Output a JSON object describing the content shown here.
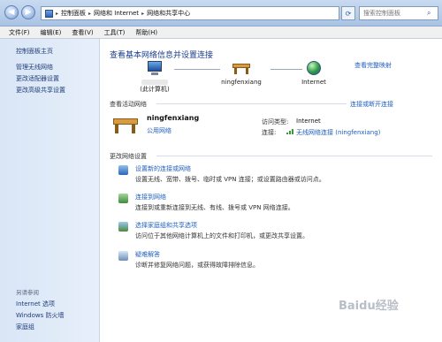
{
  "address": {
    "segments": [
      "控制面板",
      "网络和 Internet",
      "网络和共享中心"
    ],
    "search_placeholder": "搜索控制面板"
  },
  "menu": [
    "文件(F)",
    "编辑(E)",
    "查看(V)",
    "工具(T)",
    "帮助(H)"
  ],
  "sidebar": {
    "links": [
      "控制面板主页",
      "管理无线网络",
      "更改适配器设置",
      "更改高级共享设置"
    ],
    "see_also_label": "另请参阅",
    "see_also": [
      "Internet 选项",
      "Windows 防火墙",
      "家庭组"
    ]
  },
  "main": {
    "heading": "查看基本网络信息并设置连接",
    "full_map_link": "查看完整映射",
    "map": {
      "computer_label": "(此计算机)",
      "network_label": "ningfenxiang",
      "internet_label": "Internet"
    },
    "active_section": "查看活动网络",
    "connect_link": "连接或断开连接",
    "network": {
      "name": "ningfenxiang",
      "type": "公用网络",
      "access_type_label": "访问类型:",
      "access_type_value": "Internet",
      "connection_label": "连接:",
      "connection_value": "无线网络连接 (ningfenxiang)"
    },
    "change_section": "更改网络设置",
    "tasks": [
      {
        "title": "设置新的连接或网络",
        "desc": "设置无线、宽带、拨号、临时或 VPN 连接；或设置路由器或访问点。",
        "icon": "new-connection-icon"
      },
      {
        "title": "连接到网络",
        "desc": "连接到或重新连接到无线、有线、拨号或 VPN 网络连接。",
        "icon": "connect-network-icon"
      },
      {
        "title": "选择家庭组和共享选项",
        "desc": "访问位于其他网络计算机上的文件和打印机，或更改共享设置。",
        "icon": "homegroup-icon"
      },
      {
        "title": "疑难解答",
        "desc": "诊断并修复网络问题，或获得故障排除信息。",
        "icon": "troubleshoot-icon"
      }
    ]
  },
  "watermark": "Baidu经验"
}
